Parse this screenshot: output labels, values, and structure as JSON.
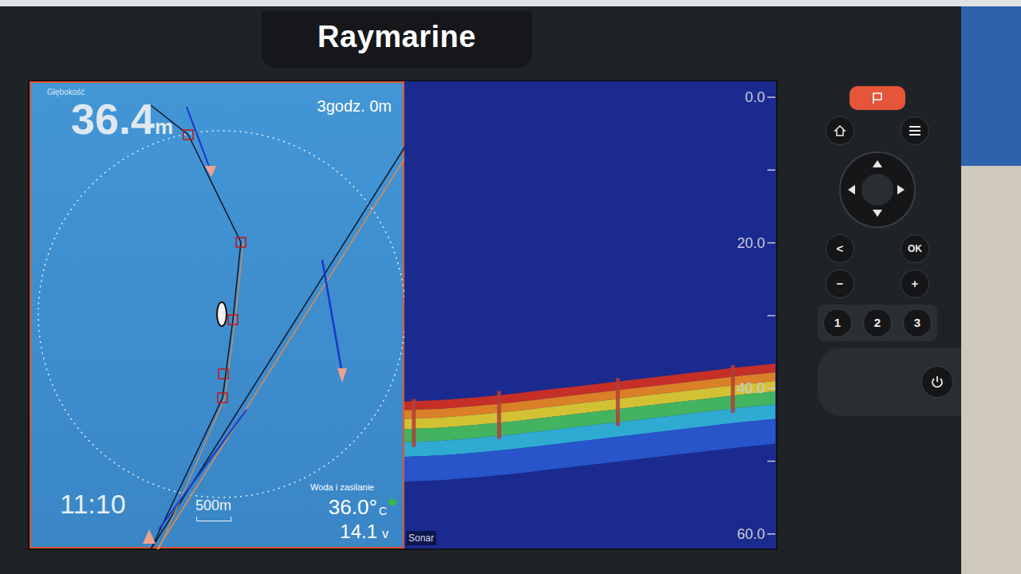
{
  "device": {
    "brand": "Raymarine"
  },
  "chart": {
    "depth_label": "Głębokość",
    "depth": "36.4",
    "depth_unit": "m",
    "timer": "3godz. 0m",
    "time": "11:10",
    "scale": "500m",
    "water_label": "Woda i zasilanie",
    "temperature": "36.0°",
    "temperature_unit": "C",
    "voltage": "14.1",
    "voltage_unit": "v"
  },
  "sonar": {
    "label": "Sonar",
    "depth_ticks": [
      "0.0",
      "20.0",
      "40.0",
      "60.0"
    ],
    "bottom_depth_m": [
      41.8,
      41.6,
      41.2,
      40.7,
      40.1,
      39.5,
      38.9,
      38.3,
      37.7,
      37.1,
      36.6
    ]
  },
  "keys": {
    "back": "<",
    "ok": "OK",
    "minus": "−",
    "plus": "+",
    "numbers": [
      "1",
      "2",
      "3"
    ]
  }
}
